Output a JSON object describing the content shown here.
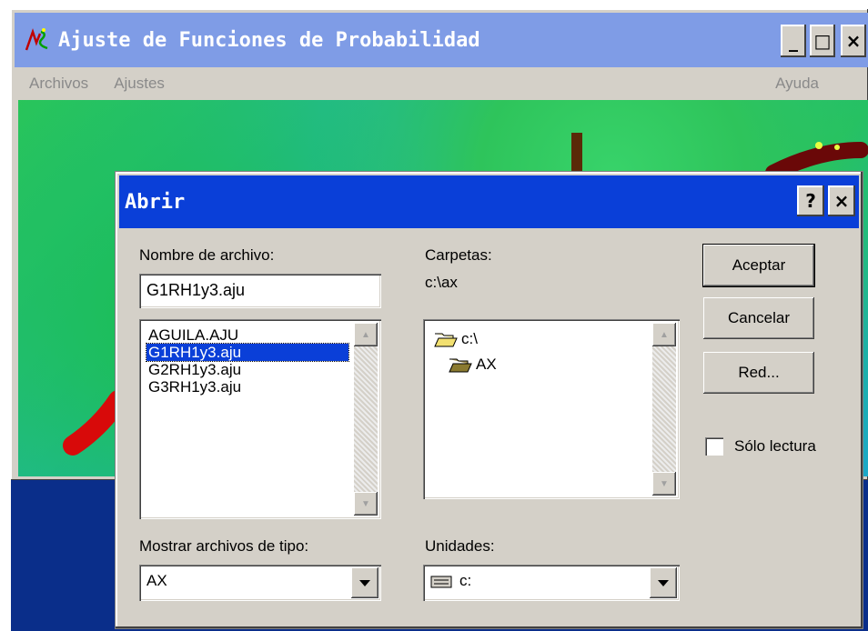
{
  "main_window": {
    "title": "Ajuste de Funciones de Probabilidad",
    "controls": {
      "minimize": "_",
      "maximize": "□",
      "close": "×"
    },
    "menu": {
      "archivos": "Archivos",
      "ajustes": "Ajustes",
      "ayuda": "Ayuda"
    }
  },
  "dialog": {
    "title": "Abrir",
    "controls": {
      "help": "?",
      "close": "×"
    },
    "file_name_label": "Nombre de archivo:",
    "file_name_value": "G1RH1y3.aju",
    "files": [
      "AGUILA.AJU",
      "G1RH1y3.aju",
      "G2RH1y3.aju",
      "G3RH1y3.aju"
    ],
    "selected_file": "G1RH1y3.aju",
    "folders_label": "Carpetas:",
    "current_path": "c:\\ax",
    "folders": [
      "c:\\",
      "AX"
    ],
    "file_type_label": "Mostrar archivos de tipo:",
    "file_type_value": "AX",
    "drives_label": "Unidades:",
    "drive_value": "c:",
    "buttons": {
      "ok": "Aceptar",
      "cancel": "Cancelar",
      "network": "Red..."
    },
    "readonly_label": "Sólo lectura",
    "readonly_checked": false
  }
}
